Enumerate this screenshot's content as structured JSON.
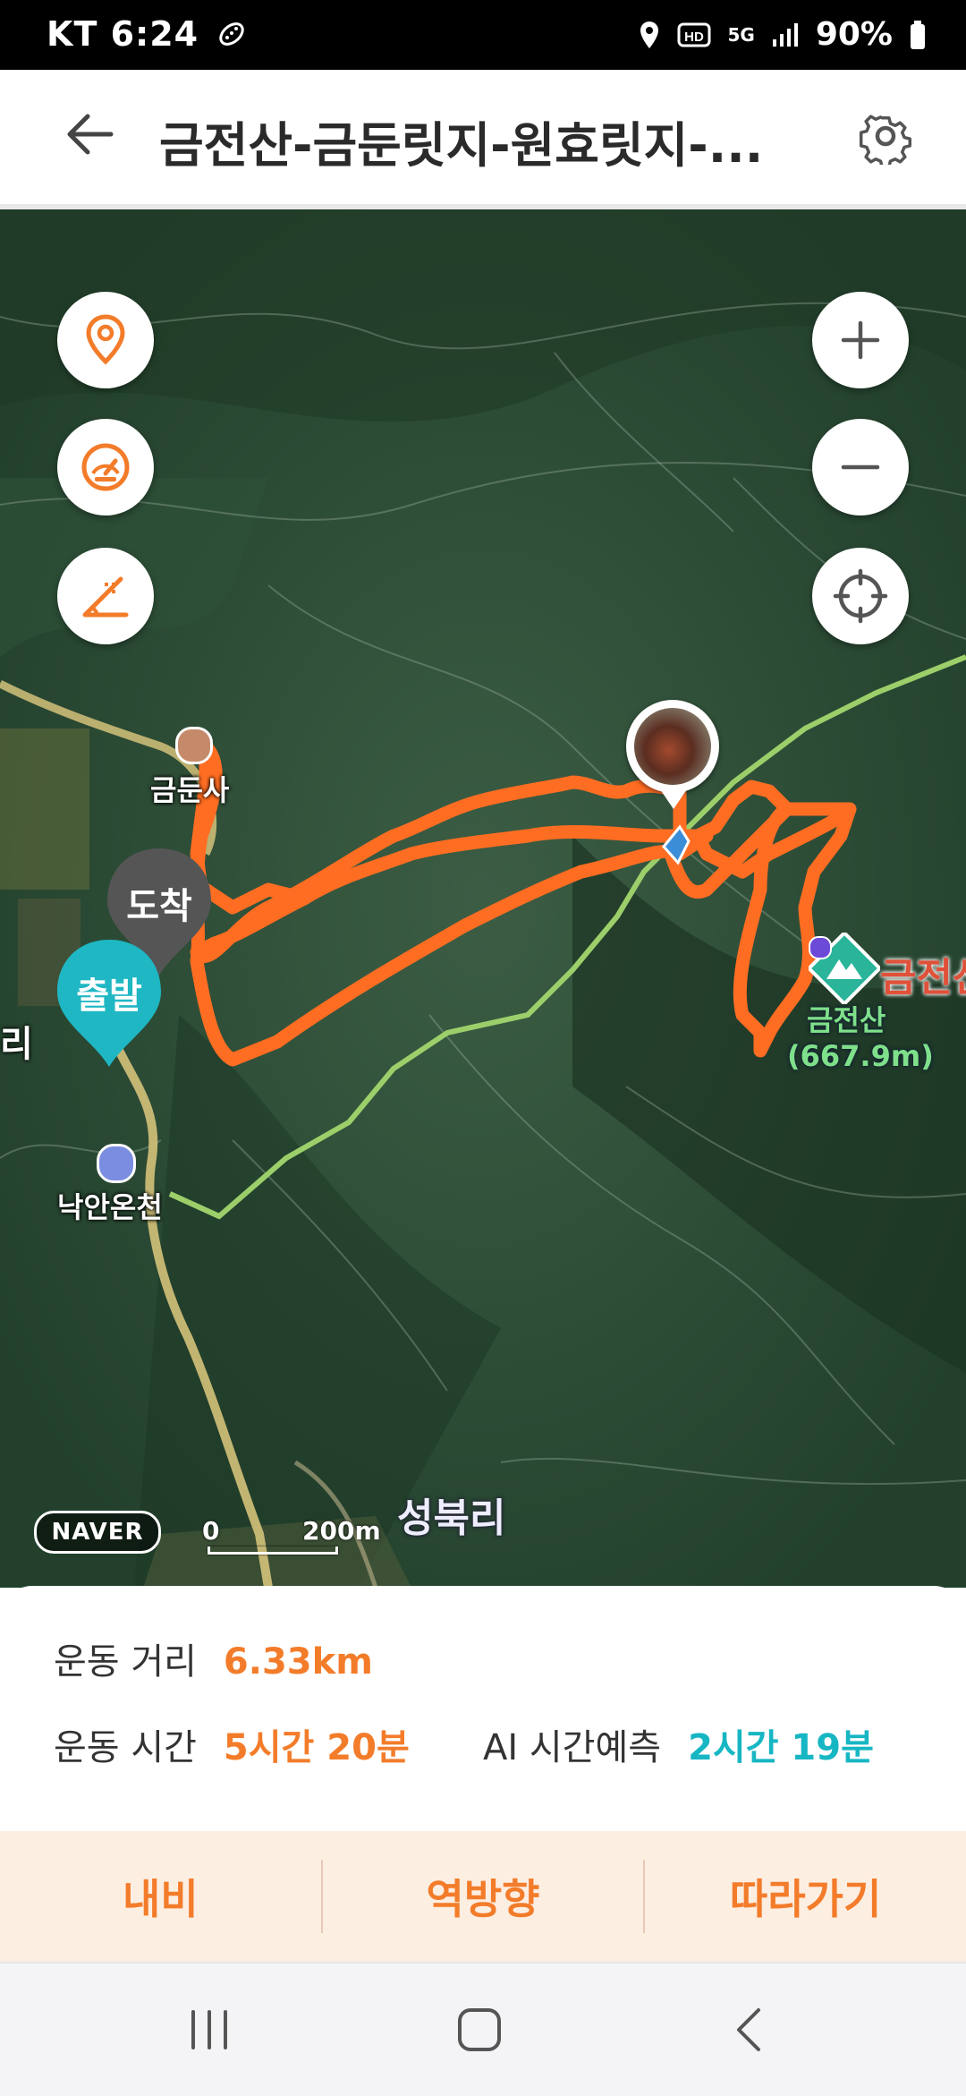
{
  "status_bar": {
    "carrier_time": "KT 6:24",
    "battery": "90%",
    "net": "5G"
  },
  "header": {
    "title": "금전산-금둔릿지-원효릿지-..."
  },
  "map": {
    "labels": {
      "temple": "금둔사",
      "arrival_pin": "도착",
      "departure_pin": "출발",
      "hot_spring": "낙안온천",
      "peak_name": "금전산",
      "peak_label_1": "금전산",
      "peak_label_2": "(667.9m)",
      "village": "성북리",
      "left_edge": "리"
    },
    "scale": {
      "zero": "0",
      "distance": "200m"
    },
    "brand": "NAVER"
  },
  "stats": {
    "distance_label": "운동 거리",
    "distance_value": "6.33km",
    "time_label": "운동 시간",
    "time_value": "5시간 20분",
    "ai_label": "AI 시간예측",
    "ai_value": "2시간 19분"
  },
  "actions": {
    "nav": "내비",
    "reverse": "역방향",
    "follow": "따라가기"
  },
  "colors": {
    "accent": "#f37c2a",
    "teal": "#17b6c3",
    "track": "#ff6d22"
  }
}
